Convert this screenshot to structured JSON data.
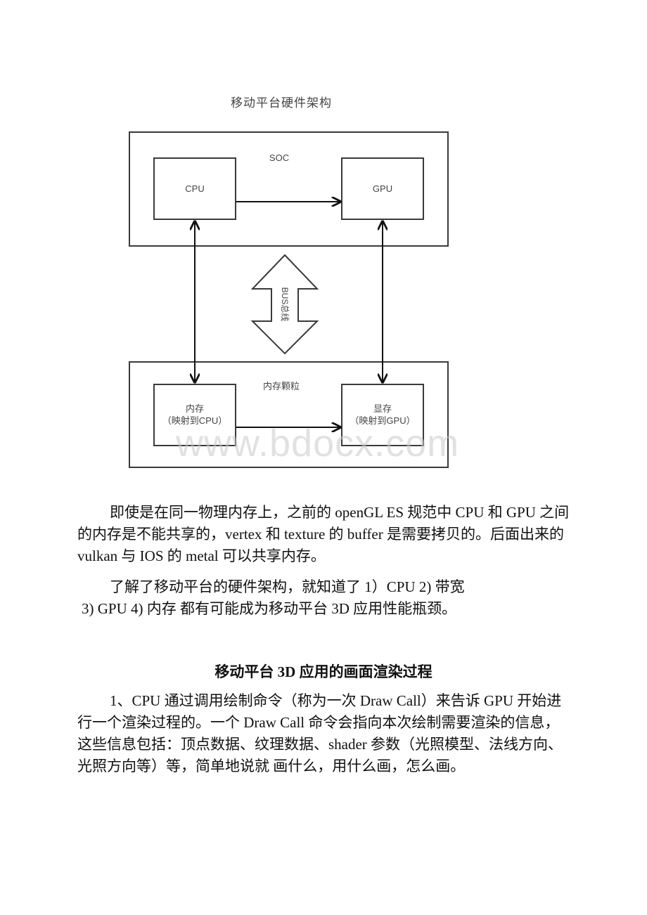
{
  "diagram": {
    "title": "移动平台硬件架构",
    "soc_label": "SOC",
    "cpu_label": "CPU",
    "gpu_label": "GPU",
    "bus_label": "BUS总线",
    "memory_group_label": "内存颗粒",
    "ram_label_line1": "内存",
    "ram_label_line2": "（映射到CPU）",
    "vram_label_line1": "显存",
    "vram_label_line2": "（映射到GPU）"
  },
  "watermark": "www.bdocx.com",
  "paragraphs": [
    "即使是在同一物理内存上，之前的 openGL ES 规范中 CPU 和 GPU 之间的内存是不能共享的，vertex 和 texture 的 buffer 是需要拷贝的。后面出来的 vulkan 与 IOS 的 metal 可以共享内存。",
    "了解了移动平台的硬件架构，就知道了 1）CPU 2) 带宽",
    "3) GPU 4) 内存 都有可能成为移动平台 3D 应用性能瓶颈。"
  ],
  "section_heading": "移动平台 3D 应用的画面渲染过程",
  "section_paragraphs": [
    "1、CPU 通过调用绘制命令（称为一次 Draw Call）来告诉 GPU 开始进行一个渲染过程的。一个 Draw Call 命令会指向本次绘制需要渲染的信息，这些信息包括：顶点数据、纹理数据、shader 参数（光照模型、法线方向、光照方向等）等，简单地说就 画什么，用什么画，怎么画。"
  ]
}
